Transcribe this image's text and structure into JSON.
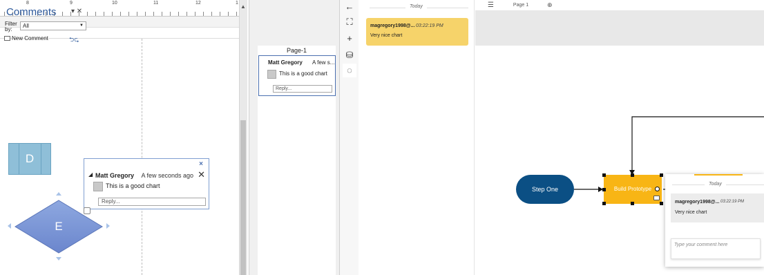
{
  "visio": {
    "ruler_numbers": [
      "8",
      "9",
      "10",
      "11",
      "12",
      "1"
    ],
    "shape_d_label": "D",
    "shape_e_label": "E",
    "callout": {
      "close": "×",
      "collapse_glyph": "◢",
      "author": "Matt Gregory",
      "time": "A few seconds ago",
      "delete_glyph": "✕",
      "text": "This is a good chart",
      "reply_placeholder": "Reply..."
    }
  },
  "comments_pane": {
    "title": "Comments",
    "controls": "▾ ✕",
    "filter_label": "Filter by:",
    "filter_value": "All",
    "new_comment": "New Comment",
    "prev_next": "⮌⮎",
    "page": "Page-1",
    "card": {
      "author": "Matt Gregory",
      "snippet": "A few s...",
      "text": "This is a good chart",
      "reply_placeholder": "Reply..."
    }
  },
  "drawio_sidebar": {
    "back": "←",
    "shapes": "⛶",
    "add": "+",
    "data": "⛁",
    "comments": "◌"
  },
  "drawio_comments": {
    "group": "Today",
    "user": "magregory1998@...",
    "time": "03:22:19 PM",
    "text": "Very nice chart"
  },
  "drawio_canvas": {
    "menu_icon": "☰",
    "page_tab": "Page 1",
    "add_page": "⊕",
    "nodes": {
      "step_one": "Step One",
      "build_prototype": "Build Prototype"
    },
    "accent": "#f8b515",
    "step_one_color": "#0b4f84",
    "popup": {
      "group": "Today",
      "user": "magregory1998@...",
      "time": "03:22:19 PM",
      "text": "Very nice chart",
      "input_placeholder": "Type your comment here"
    }
  }
}
